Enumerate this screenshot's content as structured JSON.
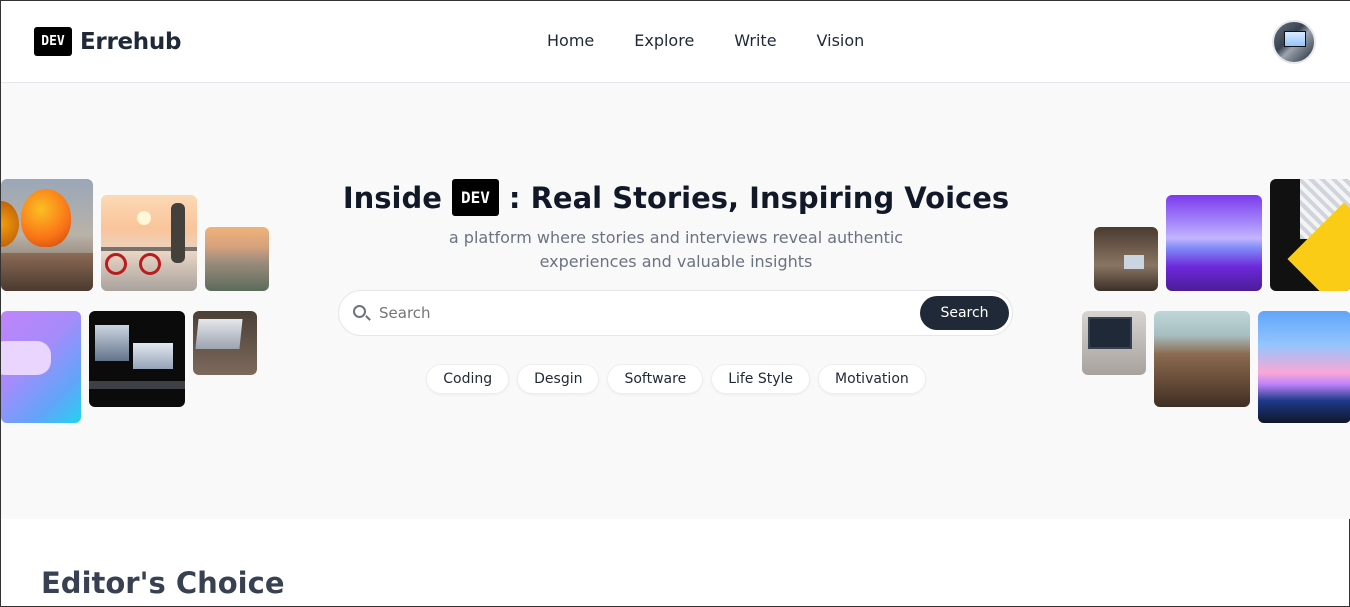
{
  "nav": {
    "logo_badge": "DEV",
    "brand": "Errehub",
    "links": [
      "Home",
      "Explore",
      "Write",
      "Vision"
    ]
  },
  "hero": {
    "title_pre": "Inside",
    "title_badge": "DEV",
    "title_post": ": Real Stories, Inspiring Voices",
    "subtitle": "a platform where stories and interviews reveal authentic experiences and valuable insights",
    "search": {
      "placeholder": "Search",
      "button": "Search"
    },
    "tags": [
      "Coding",
      "Desgin",
      "Software",
      "Life Style",
      "Motivation"
    ]
  },
  "sections": {
    "editors_choice": "Editor's Choice"
  }
}
